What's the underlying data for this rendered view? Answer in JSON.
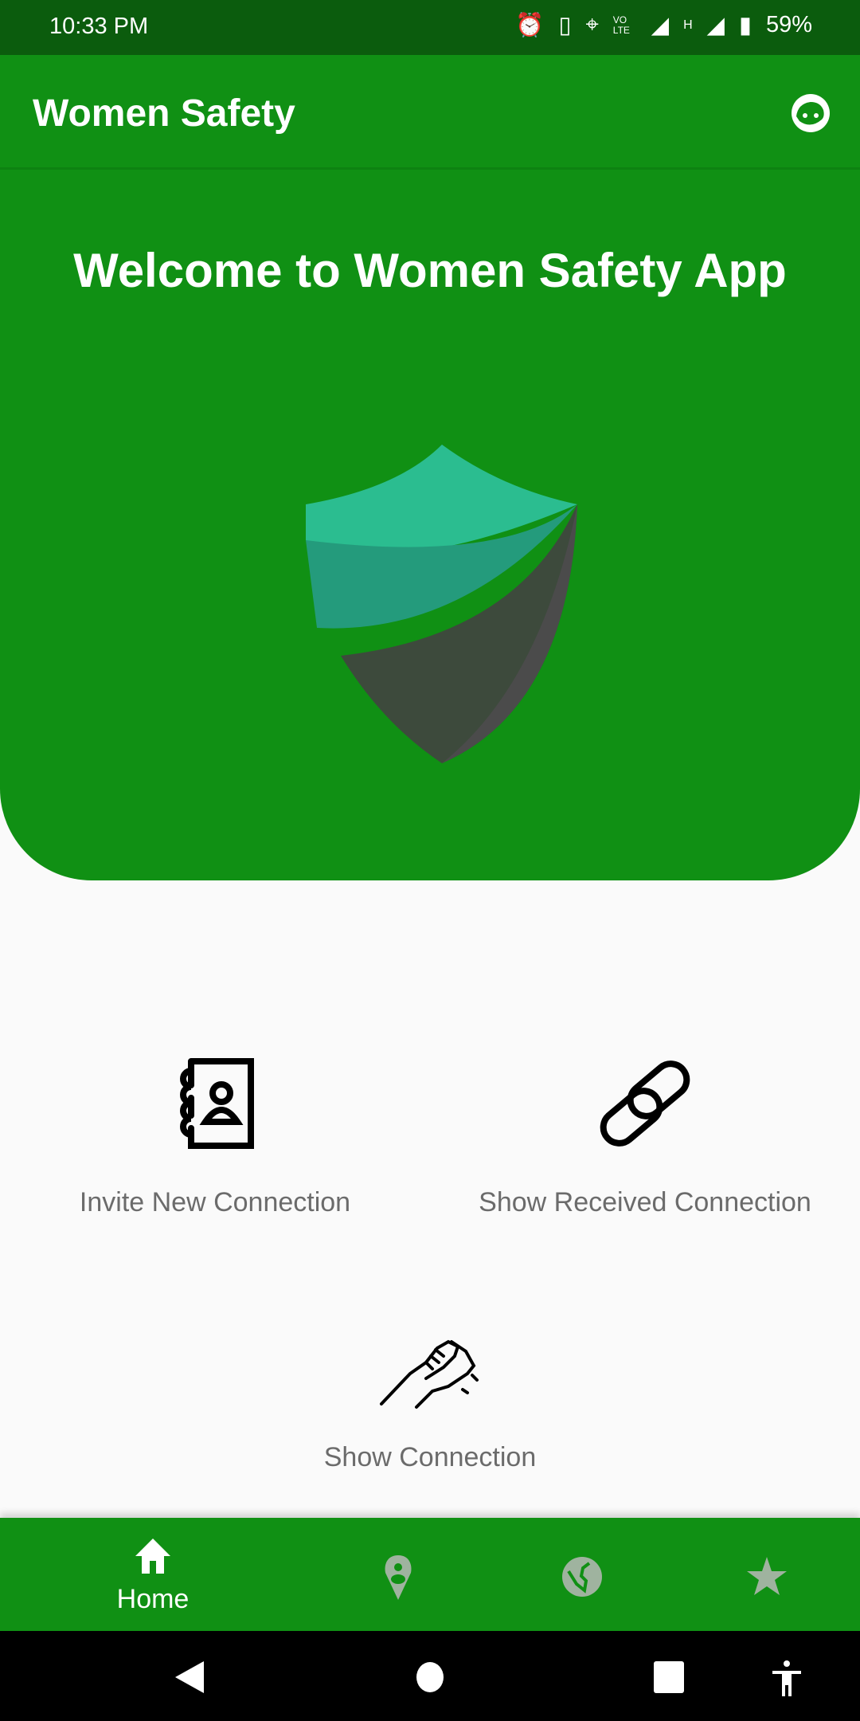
{
  "status_bar": {
    "time": "10:33 PM",
    "battery": "59%",
    "network": "H",
    "volte": "VO LTE"
  },
  "app_bar": {
    "title": "Women Safety",
    "profile_icon": "face-icon"
  },
  "hero": {
    "title": "Welcome to Women Safety App",
    "logo": "shield-logo"
  },
  "actions": [
    {
      "label": "Invite New Connection",
      "icon": "contact-book-icon"
    },
    {
      "label": "Show Received Connection",
      "icon": "link-icon"
    },
    {
      "label": "Show Connection",
      "icon": "handshake-icon"
    }
  ],
  "bottom_nav": {
    "items": [
      {
        "label": "Home",
        "icon": "home-icon",
        "active": true
      },
      {
        "label": "",
        "icon": "location-pin-icon",
        "active": false
      },
      {
        "label": "",
        "icon": "globe-icon",
        "active": false
      },
      {
        "label": "",
        "icon": "star-icon",
        "active": false
      }
    ],
    "active_color": "#ffffff",
    "inactive_color": "#9fb39f"
  },
  "colors": {
    "primary": "#109014",
    "status_bar": "#0b5c0d"
  }
}
